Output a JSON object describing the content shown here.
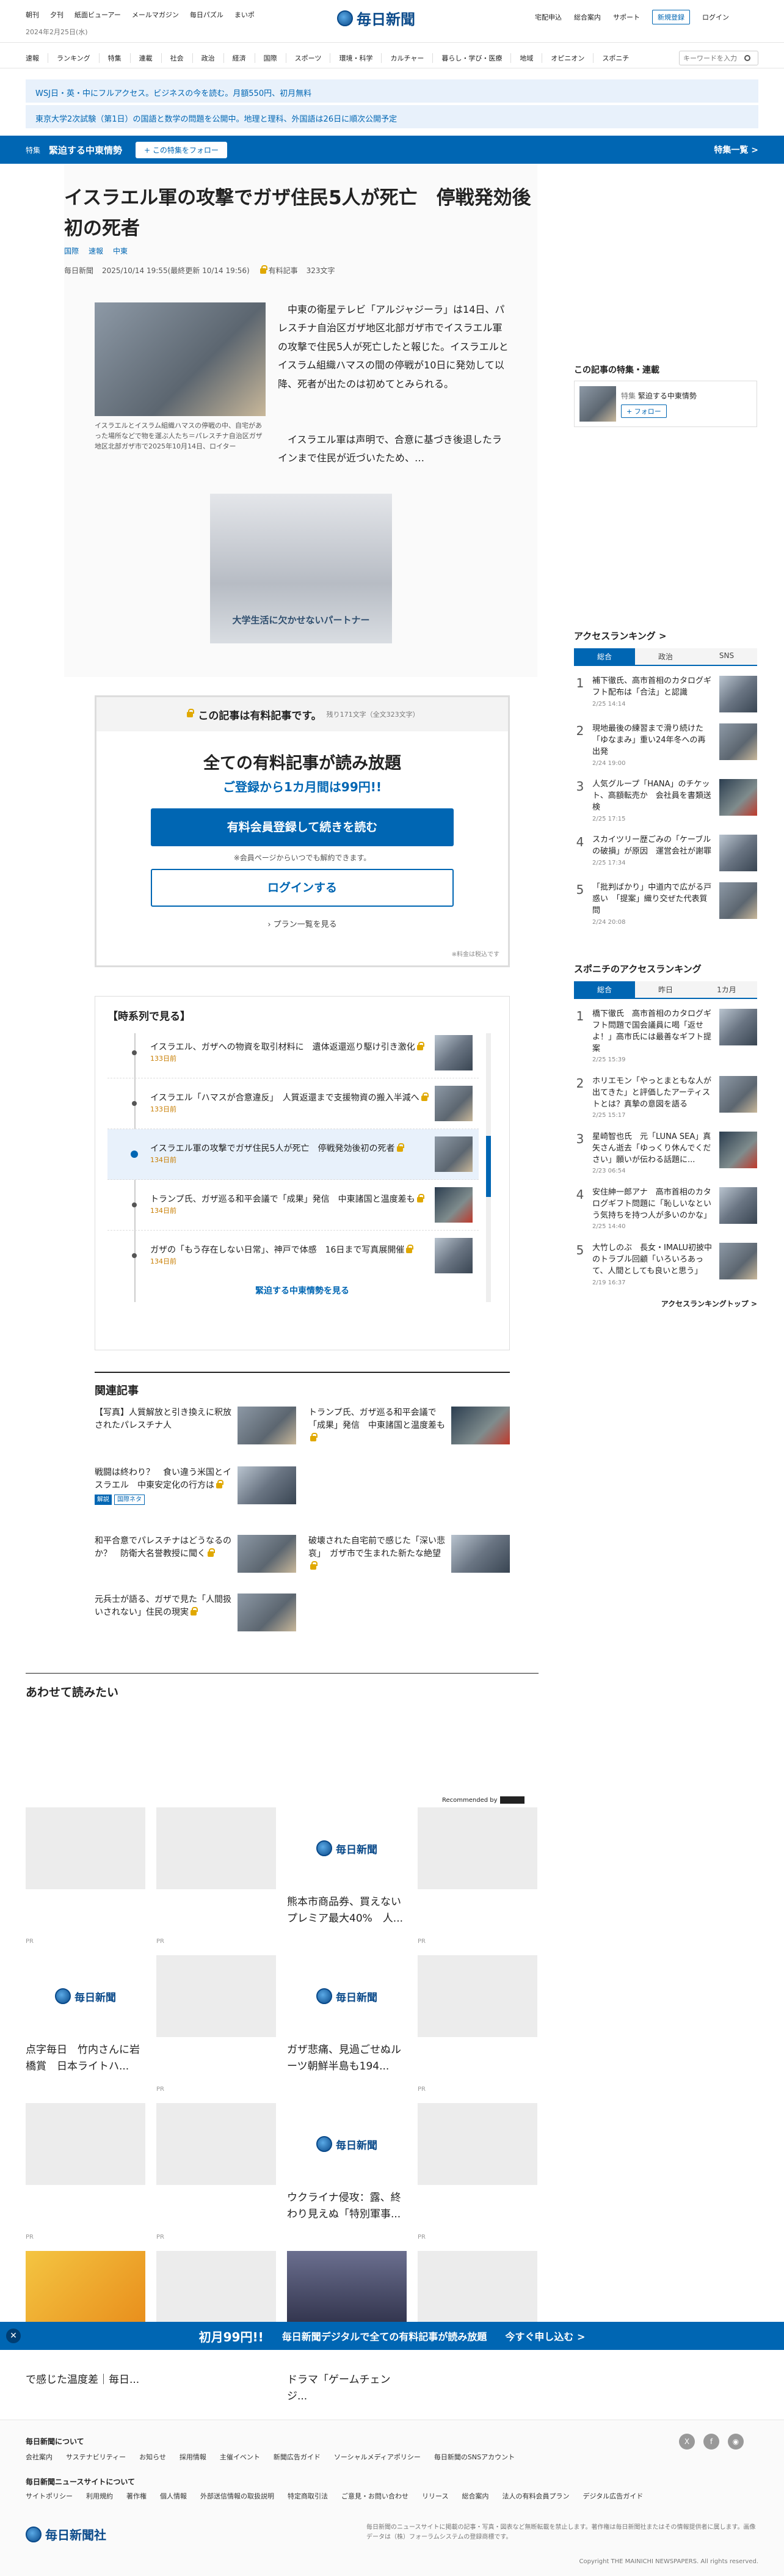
{
  "top": {
    "date": "2024年2月25日(水)",
    "links": [
      "朝刊",
      "夕刊",
      "紙面ビューアー",
      "メールマガジン",
      "毎日パズル",
      "まいポ"
    ],
    "right": [
      "宅配申込",
      "総合案内",
      "サポート"
    ],
    "signup": "新規登録",
    "login": "ログイン",
    "logo": "毎日新聞"
  },
  "nav": {
    "items": [
      "速報",
      "ランキング",
      "特集",
      "連載",
      "社会",
      "政治",
      "経済",
      "国際",
      "スポーツ",
      "環境・科学",
      "カルチャー",
      "暮らし・学び・医療",
      "地域",
      "オピニオン",
      "スポニチ"
    ],
    "search_placeholder": "キーワードを入力"
  },
  "banners": [
    "WSJ日・英・中にフルアクセス。ビジネスの今を読む。月額550円、初月無料",
    "東京大学2次試験（第1日）の国語と数学の問題を公開中。地理と理科、外国語は26日に順次公開予定"
  ],
  "feature": {
    "tag": "特集",
    "title": "緊迫する中東情勢",
    "follow": "+ この特集をフォロー",
    "list": "特集一覧 >"
  },
  "article": {
    "title": "イスラエル軍の攻撃でガザ住民5人が死亡　停戦発効後初の死者",
    "cats": [
      "国際",
      "速報",
      "中東"
    ],
    "source": "毎日新聞",
    "date": "2025/10/14 19:55(最終更新 10/14 19:56)",
    "paid": "有料記事",
    "chars": "323文字",
    "caption": "イスラエルとイスラム組織ハマスの停戦の中、自宅があった場所などで物を運ぶ人たち＝パレスチナ自治区ガザ地区北部ガザ市で2025年10月14日、ロイター",
    "body1": "　中東の衛星テレビ「アルジャジーラ」は14日、パレスチナ自治区ガザ地区北部ガザ市でイスラエル軍の攻撃で住民5人が死亡したと報じた。イスラエルとイスラム組織ハマスの間の停戦が10日に発効して以降、死者が出たのは初めてとみられる。",
    "body2": "　イスラエル軍は声明で、合意に基づき後退したラインまで住民が近づいたため、…",
    "ad_text": "大学生活に欠かせないパートナー"
  },
  "paywall": {
    "label": "この記事は有料記事です。",
    "remain": "残り171文字（全文323文字）",
    "headline": "全ての有料記事が読み放題",
    "sub": "ご登録から1カ月間は99円!!",
    "cta": "有料会員登録して続きを読む",
    "note": "※会員ページからいつでも解約できます。",
    "login": "ログインする",
    "plans": "プラン一覧を見る",
    "foot": "※料金は税込です"
  },
  "timeline": {
    "title": "【時系列で見る】",
    "items": [
      {
        "t": "イスラエル、ガザへの物資を取引材料に　遺体返還巡り駆け引き激化",
        "d": "133日前"
      },
      {
        "t": "イスラエル「ハマスが合意違反」　人質返還まで支援物資の搬入半減へ",
        "d": "133日前"
      },
      {
        "t": "イスラエル軍の攻撃でガザ住民5人が死亡　停戦発効後初の死者",
        "d": "134日前"
      },
      {
        "t": "トランプ氏、ガザ巡る和平会議で「成果」発信　中東諸国と温度差も",
        "d": "134日前"
      },
      {
        "t": "ガザの「もう存在しない日常」、神戸で体感　16日まで写真展開催",
        "d": "134日前"
      }
    ],
    "more": "緊迫する中東情勢を見る"
  },
  "related": {
    "title": "関連記事",
    "items": [
      "【写真】人質解放と引き換えに釈放されたパレスチナ人",
      "トランプ氏、ガザ巡る和平会議で「成果」発信　中東諸国と温度差も",
      "戦闘は終わり？　食い違う米国とイスラエル　中東安定化の行方は",
      "和平合意でパレスチナはどうなるのか？　防衛大名誉教授に聞く",
      "破壊された自宅前で感じた「深い悲哀」　ガザ市で生まれた新たな絶望",
      "元兵士が語る、ガザで見た「人間扱いされない」住民の現実"
    ],
    "badges": [
      "解説",
      "国際ネタ"
    ]
  },
  "recommend": {
    "title": "あわせて読みたい",
    "by": "Recommended by",
    "cards": [
      "熊本市商品券、買えないプレミア最大40%　人...",
      "点字毎日　竹内さんに岩橋賞　日本ライトハ...",
      "ガザ悲痛、見過ごせぬルーツ朝鮮半島も194...",
      "ウクライナ侵攻：露、終わり見えぬ「特別軍事...",
      "で感じた温度差｜毎日...",
      "ドラマ「ゲームチェンジ..."
    ],
    "pr": "PR"
  },
  "sidebar": {
    "feat_title": "この記事の特集・連載",
    "feat_tag": "特集",
    "feat_name": "緊迫する中東情勢",
    "feat_follow": "+ フォロー",
    "rank_title": "アクセスランキング >",
    "tabs": [
      "総合",
      "政治",
      "SNS"
    ],
    "rank": [
      {
        "t": "補下徹氏、高市首相のカタログギフト配布は「合法」と認識",
        "d": "2/25 14:14"
      },
      {
        "t": "現地最後の練習まで滑り続けた「ゆなまみ」重い24年冬への再出発",
        "d": "2/24 19:00"
      },
      {
        "t": "人気グループ「HANA」のチケット、高額転売か　会社員を書類送検",
        "d": "2/25 17:15"
      },
      {
        "t": "スカイツリー歴ごみの「ケーブルの破損」が原因　運営会社が謝罪",
        "d": "2/25 17:34"
      },
      {
        "t": "「批判ばかり」中道内で広がる戸惑い　「提案」織り交ぜた代表質問",
        "d": "2/24 20:08"
      }
    ],
    "spo_title": "スポニチのアクセスランキング",
    "spo_tabs": [
      "総合",
      "昨日",
      "1カ月"
    ],
    "spo": [
      {
        "t": "橋下徹氏　高市首相のカタログギフト問題で国会議員に喝「返せよ！」高市氏には最善なギフト提案",
        "d": "2/25 15:39"
      },
      {
        "t": "ホリエモン「やっとまともな人が出てきた」と評価したアーティストとは？真摯の意図を語る",
        "d": "2/25 15:17"
      },
      {
        "t": "星崎智也氏　元「LUNA SEA」真矢さん逝去「ゆっくり休んでください」願いが伝わる話題に...",
        "d": "2/23 06:54"
      },
      {
        "t": "安住紳一郎アナ　高市首相のカタログギフト問題に「恥しいなという気持ちを持つ人が多いのかな」",
        "d": "2/25 14:40"
      },
      {
        "t": "大竹しのぶ　長女・IMALU初披中のトラブル回顧「いろいろあって、人間としても良いと思う」",
        "d": "2/19 16:37"
      }
    ],
    "spo_more": "アクセスランキングトップ >"
  },
  "bottom_bar": {
    "price": "初月99円!!",
    "msg": "毎日新聞デジタルで全ての有料記事が読み放題",
    "cta": "今すぐ申し込む  >"
  },
  "footer": {
    "h1": "毎日新聞について",
    "links1": [
      "会社案内",
      "サステナビリティー",
      "お知らせ",
      "採用情報",
      "主催イベント",
      "新聞広告ガイド",
      "ソーシャルメディアポリシー",
      "毎日新聞のSNSアカウント"
    ],
    "h2": "毎日新聞ニュースサイトについて",
    "links2": [
      "サイトポリシー",
      "利用規約",
      "著作権",
      "個人情報",
      "外部送信情報の取扱説明",
      "特定商取引法",
      "ご意見・お問い合わせ",
      "リリース",
      "総合案内",
      "法人の有料会員プラン",
      "デジタル広告ガイド"
    ],
    "logo": "毎日新聞社",
    "notice": "毎日新聞のニュースサイトに掲載の記事・写真・図表など無断転載を禁止します。著作権は毎日新聞社またはその情報提供者に属します。画像データは（株）フォーラムシステムの登録商標です。",
    "copy": "Copyright THE MAINICHI NEWSPAPERS. All rights reserved."
  }
}
